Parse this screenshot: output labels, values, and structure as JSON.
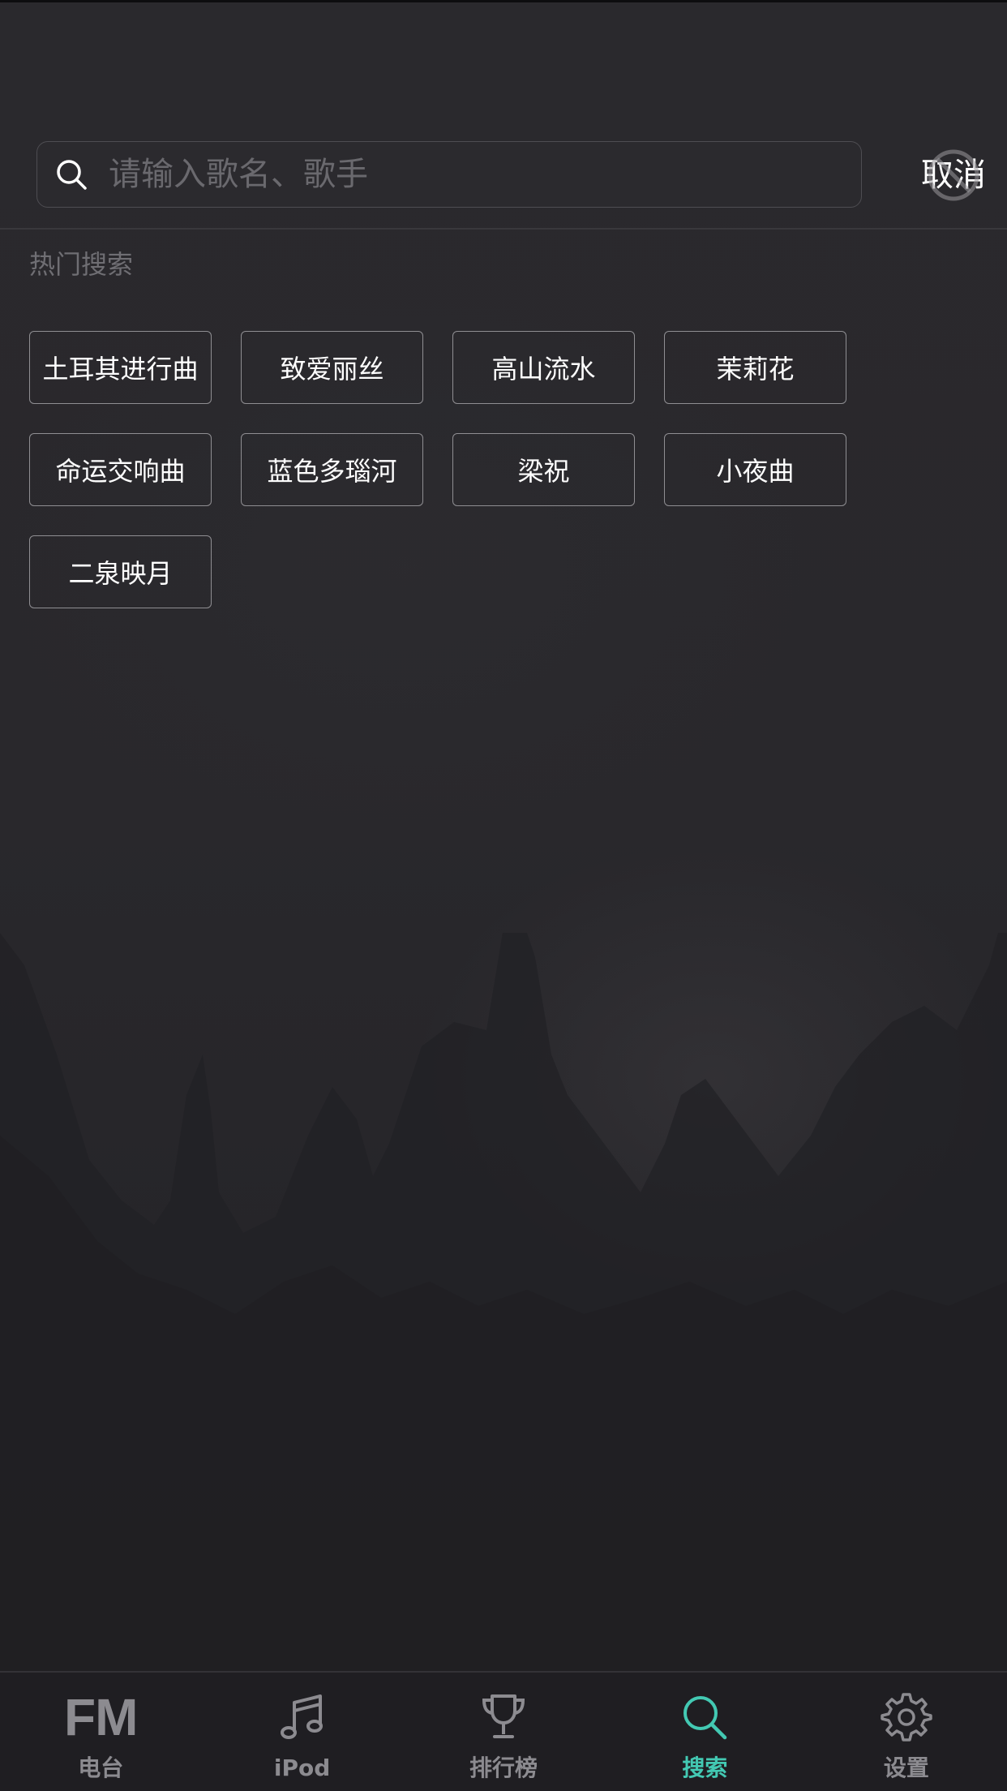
{
  "search": {
    "placeholder": "请输入歌名、歌手",
    "value": "",
    "cancel_label": "取消"
  },
  "hot_search": {
    "title": "热门搜索",
    "tags": [
      "土耳其进行曲",
      "致爱丽丝",
      "高山流水",
      "茉莉花",
      "命运交响曲",
      "蓝色多瑙河",
      "梁祝",
      "小夜曲",
      "二泉映月"
    ]
  },
  "tabbar": {
    "active_tab": "搜索",
    "active_color": "#43c9b3",
    "inactive_color": "#8c8b90",
    "tabs": [
      {
        "label": "电台",
        "icon": "fm-icon",
        "icon_text": "FM"
      },
      {
        "label": "iPod",
        "icon": "music-note-icon"
      },
      {
        "label": "排行榜",
        "icon": "trophy-icon"
      },
      {
        "label": "搜索",
        "icon": "search-icon"
      },
      {
        "label": "设置",
        "icon": "gear-icon"
      }
    ]
  }
}
